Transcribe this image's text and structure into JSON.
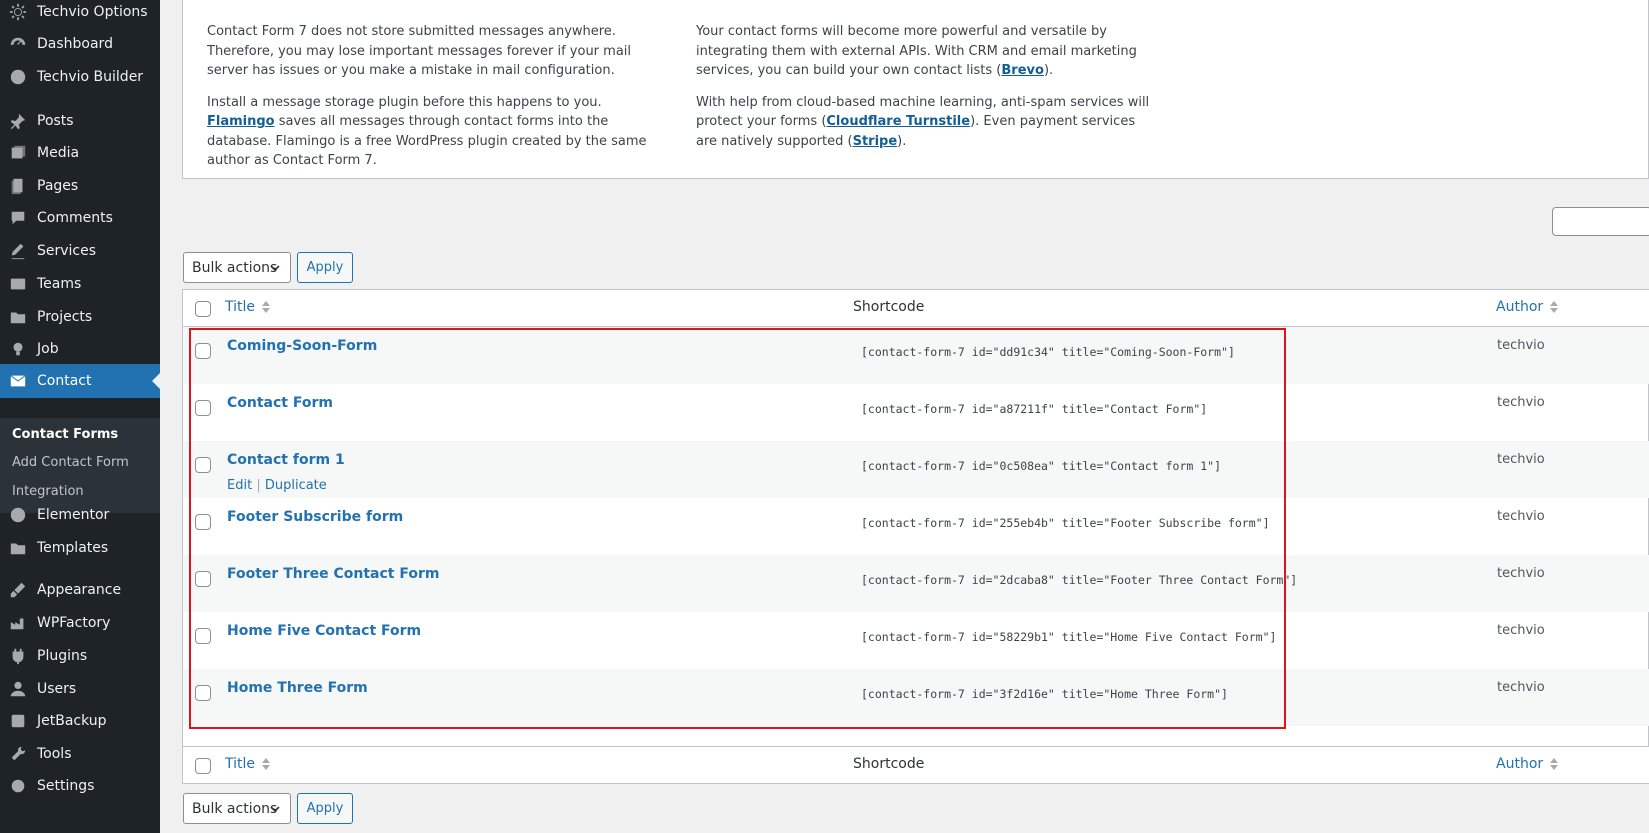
{
  "sidebar": {
    "items": [
      {
        "label": "Techvio Options",
        "icon": "gear-icon"
      },
      {
        "label": "Dashboard",
        "icon": "dashboard-icon"
      },
      {
        "label": "Techvio Builder",
        "icon": "globe-icon"
      },
      {
        "label": "Posts",
        "icon": "pin-icon"
      },
      {
        "label": "Media",
        "icon": "media-icon"
      },
      {
        "label": "Pages",
        "icon": "pages-icon"
      },
      {
        "label": "Comments",
        "icon": "comment-icon"
      },
      {
        "label": "Services",
        "icon": "edit-icon"
      },
      {
        "label": "Teams",
        "icon": "id-card-icon"
      },
      {
        "label": "Projects",
        "icon": "folder-icon"
      },
      {
        "label": "Job",
        "icon": "lightbulb-icon"
      },
      {
        "label": "Contact",
        "icon": "envelope-icon"
      },
      {
        "label": "Elementor",
        "icon": "elementor-icon"
      },
      {
        "label": "Templates",
        "icon": "folder-open-icon"
      },
      {
        "label": "Appearance",
        "icon": "brush-icon"
      },
      {
        "label": "WPFactory",
        "icon": "factory-icon"
      },
      {
        "label": "Plugins",
        "icon": "plugin-icon"
      },
      {
        "label": "Users",
        "icon": "user-icon"
      },
      {
        "label": "JetBackup",
        "icon": "backup-icon"
      },
      {
        "label": "Tools",
        "icon": "wrench-icon"
      },
      {
        "label": "Settings",
        "icon": "settings-icon"
      }
    ],
    "active": "Contact",
    "submenu": [
      "Contact Forms",
      "Add Contact Form",
      "Integration"
    ]
  },
  "notice": {
    "left_p1": "Contact Form 7 does not store submitted messages anywhere. Therefore, you may lose important messages forever if your mail server has issues or you make a mistake in mail configuration.",
    "left_p2_before": "Install a message storage plugin before this happens to you. ",
    "left_p2_link": "Flamingo",
    "left_p2_after": " saves all messages through contact forms into the database. Flamingo is a free WordPress plugin created by the same author as Contact Form 7.",
    "right_p1_before": "Your contact forms will become more powerful and versatile by integrating them with external APIs. With CRM and email marketing services, you can build your own contact lists (",
    "right_p1_link": "Brevo",
    "right_p1_after": ").",
    "right_p2_before": "With help from cloud-based machine learning, anti-spam services will protect your forms (",
    "right_p2_link1": "Cloudflare Turnstile",
    "right_p2_mid": "). Even payment services are natively supported (",
    "right_p2_link2": "Stripe",
    "right_p2_after": ")."
  },
  "bulk": {
    "label": "Bulk actions",
    "apply": "Apply"
  },
  "table": {
    "headers": {
      "title": "Title",
      "shortcode": "Shortcode",
      "author": "Author"
    },
    "row_actions": {
      "edit": "Edit",
      "separator": " | ",
      "duplicate": "Duplicate"
    },
    "rows": [
      {
        "title": "Coming-Soon-Form",
        "shortcode": "[contact-form-7 id=\"dd91c34\" title=\"Coming-Soon-Form\"]",
        "author": "techvio"
      },
      {
        "title": "Contact Form",
        "shortcode": "[contact-form-7 id=\"a87211f\" title=\"Contact Form\"]",
        "author": "techvio"
      },
      {
        "title": "Contact form 1",
        "shortcode": "[contact-form-7 id=\"0c508ea\" title=\"Contact form 1\"]",
        "author": "techvio"
      },
      {
        "title": "Footer Subscribe form",
        "shortcode": "[contact-form-7 id=\"255eb4b\" title=\"Footer Subscribe form\"]",
        "author": "techvio"
      },
      {
        "title": "Footer Three Contact Form",
        "shortcode": "[contact-form-7 id=\"2dcaba8\" title=\"Footer Three Contact Form\"]",
        "author": "techvio"
      },
      {
        "title": "Home Five Contact Form",
        "shortcode": "[contact-form-7 id=\"58229b1\" title=\"Home Five Contact Form\"]",
        "author": "techvio"
      },
      {
        "title": "Home Three Form",
        "shortcode": "[contact-form-7 id=\"3f2d16e\" title=\"Home Three Form\"]",
        "author": "techvio"
      }
    ]
  },
  "colors": {
    "sidebar_bg": "#1d2327",
    "active_bg": "#2271b1",
    "link": "#2271b1",
    "highlight": "#e0141b"
  }
}
